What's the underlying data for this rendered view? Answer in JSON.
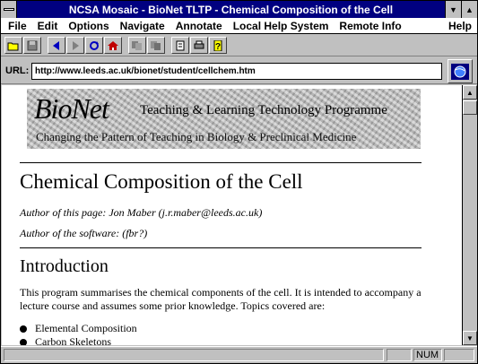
{
  "window": {
    "title": "NCSA Mosaic - BioNet TLTP - Chemical Composition of the Cell"
  },
  "menubar": {
    "items": [
      {
        "label": "File"
      },
      {
        "label": "Edit"
      },
      {
        "label": "Options"
      },
      {
        "label": "Navigate"
      },
      {
        "label": "Annotate"
      },
      {
        "label": "Local Help System"
      },
      {
        "label": "Remote Info"
      },
      {
        "label": "Help"
      }
    ]
  },
  "toolbar": {
    "icons": [
      "open-folder-icon",
      "save-disk-icon",
      "back-arrow-icon",
      "forward-arrow-icon",
      "reload-icon",
      "home-icon",
      "copy-icon",
      "paste-icon",
      "document-icon",
      "print-icon",
      "help-icon"
    ]
  },
  "urlbar": {
    "label": "URL:",
    "value": "http://www.leeds.ac.uk/bionet/student/cellchem.htm"
  },
  "page": {
    "banner_logo": "BioNet",
    "banner_title": "Teaching & Learning Technology Programme",
    "banner_subtitle": "Changing the Pattern of Teaching in Biology & Preclinical Medicine",
    "heading": "Chemical Composition of the Cell",
    "author_page": "Author of this page: Jon Maber (j.r.maber@leeds.ac.uk)",
    "author_software": "Author of the software: (fbr?)",
    "section_heading": "Introduction",
    "intro_text": "This program summarises the chemical components of the cell. It is intended to accompany a lecture course and assumes some prior knowledge. Topics covered are:",
    "topics": [
      "Elemental Composition",
      "Carbon Skeletons"
    ]
  },
  "statusbar": {
    "num_indicator": "NUM"
  },
  "colors": {
    "titlebar": "#000080",
    "chrome": "#c0c0c0"
  }
}
